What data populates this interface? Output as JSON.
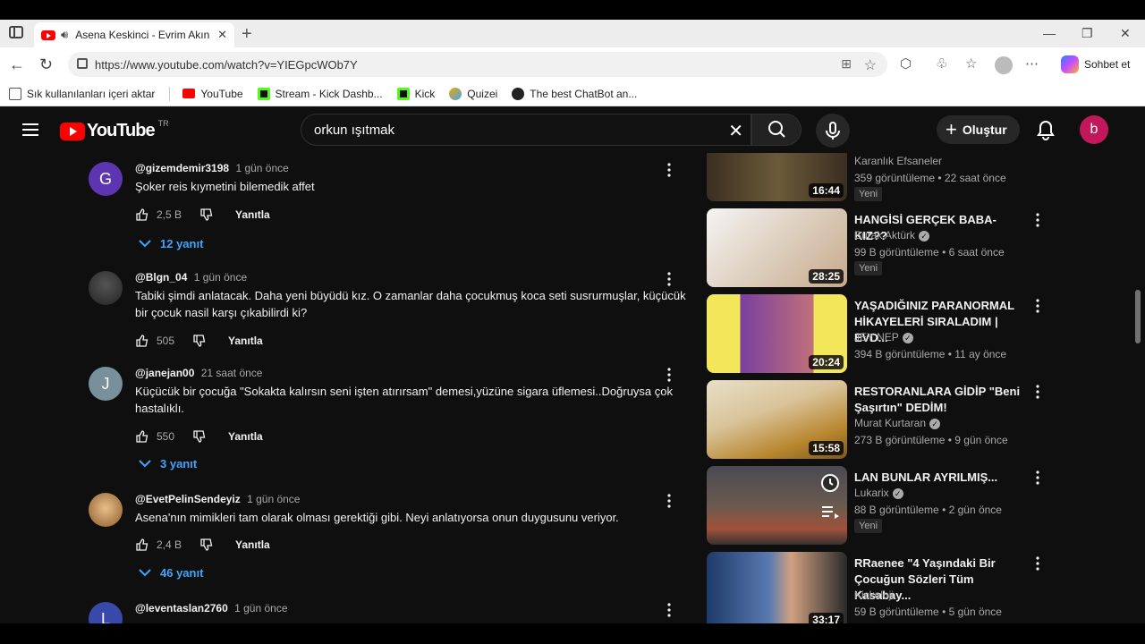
{
  "browser": {
    "tab_title": "Asena Keskinci - Evrim Akın | ",
    "url": "https://www.youtube.com/watch?v=YIEGpcWOb7Y",
    "chat_label": "Sohbet et",
    "bookmarks": [
      {
        "label": "Sık kullanılanları içeri aktar",
        "icon": "import-icon",
        "color": "#555555"
      },
      {
        "label": "YouTube",
        "icon": "youtube-icon",
        "color": "#ff0000"
      },
      {
        "label": "Stream - Kick Dashb...",
        "icon": "kick-icon",
        "color": "#53fc18"
      },
      {
        "label": "Kick",
        "icon": "kick-icon",
        "color": "#53fc18"
      },
      {
        "label": "Quizei",
        "icon": "quizei-icon",
        "color": "#f4a300"
      },
      {
        "label": "The best ChatBot an...",
        "icon": "chatbot-icon",
        "color": "#222222"
      }
    ]
  },
  "youtube": {
    "logo_text": "YouTube",
    "country_code": "TR",
    "search_value": "orkun ışıtmak",
    "create_label": "Oluştur",
    "avatar_letter": "b",
    "colors": {
      "accent": "#ff0000",
      "link": "#3ea6ff",
      "background": "#0f0f0f"
    }
  },
  "comments": [
    {
      "avatar_letter": "G",
      "avatar_color": "#5e35b1",
      "handle": "@gizemdemir3198",
      "time": "1 gün önce",
      "text": "Şoker reis kıymetini bilemedik affet",
      "likes": "2,5 B",
      "reply_label": "Yanıtla",
      "replies": "12 yanıt"
    },
    {
      "avatar_letter": "",
      "avatar_color": "#3a3a3a",
      "handle": "@Blgn_04",
      "time": "1 gün önce",
      "text": "Tabiki şimdi anlatacak. Daha yeni büyüdü kız. O zamanlar daha çocukmuş koca seti susrurmuşlar, küçücük bir çocuk nasil karşı çıkabilirdi ki?",
      "likes": "505",
      "reply_label": "Yanıtla",
      "replies": ""
    },
    {
      "avatar_letter": "J",
      "avatar_color": "#78909c",
      "handle": "@janejan00",
      "time": "21 saat önce",
      "text": "Küçücük bir çocuğa \"Sokakta kalırsın seni işten atırırsam\" demesi,yüzüne sigara üflemesi..Doğruysa çok hastalıklı.",
      "likes": "550",
      "reply_label": "Yanıtla",
      "replies": "3 yanıt"
    },
    {
      "avatar_letter": "",
      "avatar_color": "#b8860b",
      "handle": "@EvetPelinSendeyiz",
      "time": "1 gün önce",
      "text": "Asena'nın mimikleri tam olarak olması gerektiği gibi. Neyi anlatıyorsa onun duygusunu veriyor.",
      "likes": "2,4 B",
      "reply_label": "Yanıtla",
      "replies": "46 yanıt"
    },
    {
      "avatar_letter": "L",
      "avatar_color": "#3949ab",
      "handle": "@leventaslan2760",
      "time": "1 gün önce",
      "text": "",
      "likes": "",
      "reply_label": "",
      "replies": ""
    }
  ],
  "sidebar": [
    {
      "title": "",
      "channel": "Karanlık Efsaneler",
      "verified": false,
      "meta": "359 görüntüleme • 22 saat önce",
      "badge": "Yeni",
      "duration": "16:44",
      "thumb_colors": [
        "#3b2e20",
        "#6b5a3a"
      ]
    },
    {
      "title": "HANGİSİ GERÇEK BABA- KIZ??",
      "channel": "Burak Aktürk",
      "verified": true,
      "meta": "99 B görüntüleme • 6 saat önce",
      "badge": "Yeni",
      "duration": "28:25",
      "thumb_colors": [
        "#e8e8e8",
        "#c7a98a"
      ]
    },
    {
      "title": "YAŞADIĞINIZ PARANORMAL HİKAYELERİ SIRALADIM | EVD...",
      "channel": "JEY NEP",
      "verified": true,
      "meta": "394 B görüntüleme • 11 ay önce",
      "badge": "",
      "duration": "20:24",
      "thumb_colors": [
        "#f2e65a",
        "#7a3fa0"
      ]
    },
    {
      "title": "RESTORANLARA GİDİP \"Beni Şaşırtın\" DEDİM!",
      "channel": "Murat Kurtaran",
      "verified": true,
      "meta": "273 B görüntüleme • 9 gün önce",
      "badge": "",
      "duration": "15:58",
      "thumb_colors": [
        "#d9c39a",
        "#b8862e"
      ]
    },
    {
      "title": "LAN BUNLAR AYRILMIŞ...",
      "channel": "Lukarix",
      "verified": true,
      "meta": "88 B görüntüleme • 2 gün önce",
      "badge": "Yeni",
      "duration": "",
      "thumb_colors": [
        "#5a4a44",
        "#a0523a"
      ]
    },
    {
      "title": "RRaenee \"4 Yaşındaki Bir Çocuğun Sözleri Tüm Kasabay...",
      "channel": "Kickoloji",
      "verified": false,
      "meta": "59 B görüntüleme • 5 gün önce",
      "badge": "",
      "duration": "33:17",
      "thumb_colors": [
        "#1e3a6a",
        "#d0a080"
      ]
    }
  ]
}
